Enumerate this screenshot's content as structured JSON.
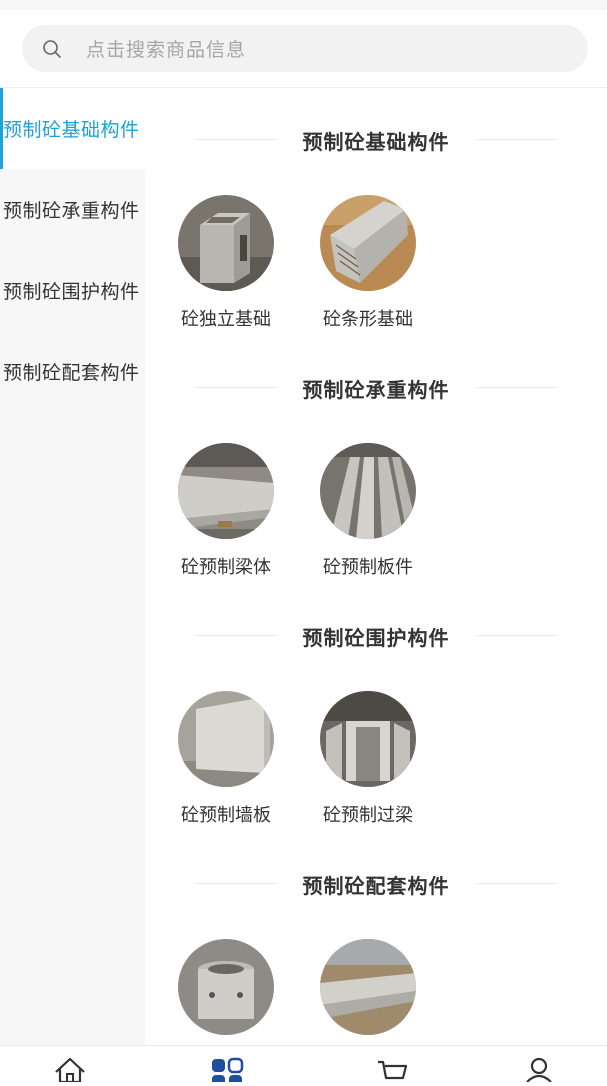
{
  "search": {
    "placeholder": "点击搜索商品信息",
    "icon": "search-icon"
  },
  "sidebar": {
    "active_color": "#1ea1d6",
    "items": [
      {
        "label": "预制砼基础构件",
        "active": true
      },
      {
        "label": "预制砼承重构件",
        "active": false
      },
      {
        "label": "预制砼围护构件",
        "active": false
      },
      {
        "label": "预制砼配套构件",
        "active": false
      }
    ]
  },
  "sections": [
    {
      "title": "预制砼基础构件",
      "items": [
        {
          "label": "砼独立基础"
        },
        {
          "label": "砼条形基础"
        }
      ]
    },
    {
      "title": "预制砼承重构件",
      "items": [
        {
          "label": "砼预制梁体"
        },
        {
          "label": "砼预制板件"
        }
      ]
    },
    {
      "title": "预制砼围护构件",
      "items": [
        {
          "label": "砼预制墙板"
        },
        {
          "label": "砼预制过梁"
        }
      ]
    },
    {
      "title": "预制砼配套构件",
      "items": [
        {
          "label": ""
        },
        {
          "label": ""
        }
      ]
    }
  ],
  "tabbar": {
    "icons": [
      "home-icon",
      "category-icon",
      "cart-icon",
      "user-icon"
    ],
    "active_index": 1
  }
}
